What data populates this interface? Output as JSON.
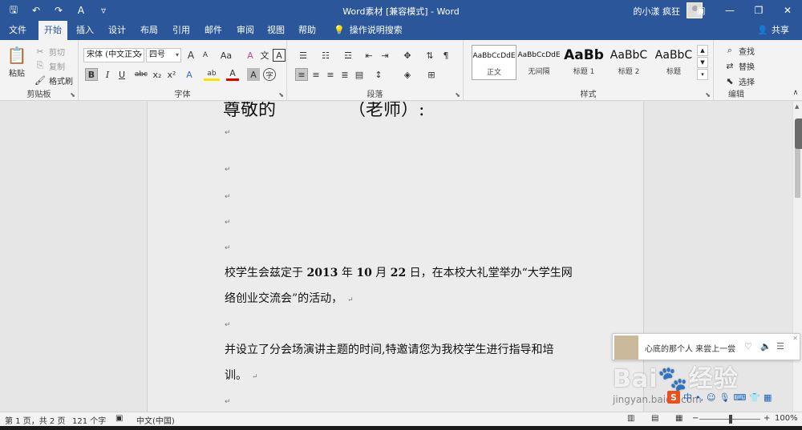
{
  "titlebar": {
    "title": "Word素材 [兼容模式] - Word",
    "user": "的小漾 疯狂",
    "qat_icons": [
      "save-icon",
      "undo-icon",
      "redo-icon",
      "format-icon",
      "customize-icon"
    ]
  },
  "tabs": [
    "文件",
    "开始",
    "插入",
    "设计",
    "布局",
    "引用",
    "邮件",
    "审阅",
    "视图",
    "帮助"
  ],
  "active_tab": "开始",
  "tellme": "操作说明搜索",
  "share": "共享",
  "clipboard": {
    "paste": "粘贴",
    "cut": "剪切",
    "copy": "复制",
    "format_painter": "格式刷",
    "label": "剪贴板"
  },
  "font": {
    "name": "宋体 (中文正文",
    "size": "四号",
    "label": "字体",
    "bold": "B",
    "italic": "I",
    "underline": "U",
    "strike": "abc",
    "sub": "x₂",
    "sup": "x²",
    "grow": "A",
    "shrink": "A",
    "case": "Aa",
    "clear": "A",
    "phonetic": "文",
    "border": "A",
    "effect": "A",
    "highlight": "ab",
    "color": "A",
    "shade": "A",
    "circle": "字"
  },
  "paragraph": {
    "label": "段落"
  },
  "styles": {
    "label": "样式",
    "items": [
      {
        "preview": "AaBbCcDdE",
        "name": "正文"
      },
      {
        "preview": "AaBbCcDdE",
        "name": "无间隔"
      },
      {
        "preview": "AaBb",
        "name": "标题 1"
      },
      {
        "preview": "AaBbC",
        "name": "标题 2"
      },
      {
        "preview": "AaBbC",
        "name": "标题"
      }
    ]
  },
  "editing": {
    "label": "编辑",
    "find": "查找",
    "replace": "替换",
    "select": "选择"
  },
  "document": {
    "heading_left": "尊敬的",
    "heading_right": "（老师）:",
    "para1_a": "校学生会兹定于 ",
    "para1_year": "2013",
    "para1_b": " 年 ",
    "para1_month": "10",
    "para1_c": " 月 ",
    "para1_day": "22",
    "para1_d": " 日，在本校大礼堂举办“大学生网",
    "para1_line2": "络创业交流会”的活动，",
    "para2_line1": "并设立了分会场演讲主题的时间,特邀请您为我校学生进行指导和培",
    "para2_line2": "训。",
    "para_mark": "↵"
  },
  "music": {
    "song": "心底的那个人 来尝上一尝"
  },
  "watermark": {
    "brand": "Bai🐾经验",
    "url": "jingyan.baidu.com"
  },
  "ime": {
    "lang": "中"
  },
  "status": {
    "page": "第 1 页，共 2 页",
    "words": "121 个字",
    "lang": "中文(中国)",
    "zoom": "100%",
    "zoom_percent": 100
  }
}
